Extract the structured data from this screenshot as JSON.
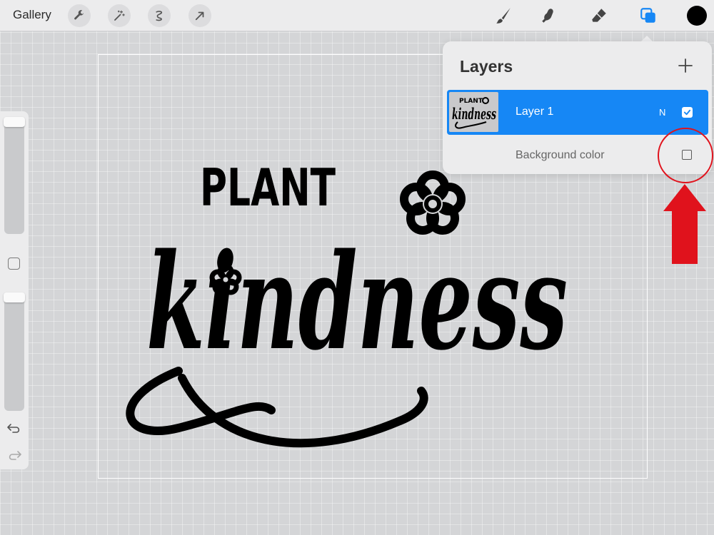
{
  "toolbar": {
    "gallery_label": "Gallery",
    "left_tools": [
      "wrench-icon",
      "magic-wand-icon",
      "selection-icon",
      "transform-arrow-icon"
    ],
    "right_tools": [
      "brush-icon",
      "smudge-icon",
      "eraser-icon",
      "layers-icon"
    ],
    "active_color": "#000000",
    "active_tool_color": "#1687f5"
  },
  "sidebar": {
    "brush_size_label": "",
    "opacity_label": ""
  },
  "canvas": {
    "artwork_text": [
      "PLANT",
      "kindness"
    ]
  },
  "layers_panel": {
    "title": "Layers",
    "add_icon": "plus-icon",
    "layers": [
      {
        "name": "Layer 1",
        "blend_mode": "N",
        "visible": true,
        "selected": true,
        "thumb_text": [
          "PLANT",
          "kindness"
        ]
      }
    ],
    "background": {
      "label": "Background color",
      "visible": false
    }
  },
  "annotation": {
    "circle_color": "#e0121c",
    "arrow_color": "#e0121c"
  }
}
